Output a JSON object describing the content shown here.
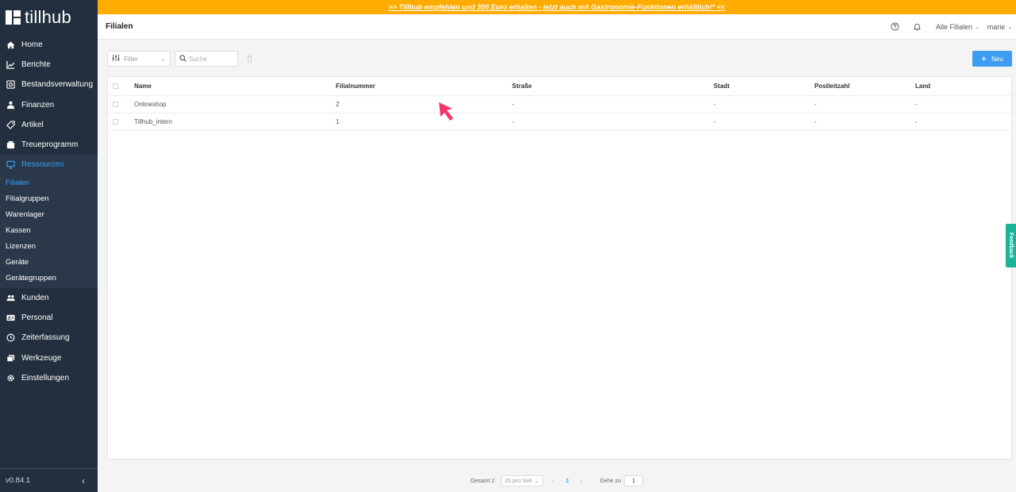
{
  "app": {
    "logo_text": "tillhub"
  },
  "banner": {
    "text": ">> Tillhub empfehlen und 300 Euro erhalten - jetzt auch mit Gastronomie-Funktionen erhältlich!* <<"
  },
  "header": {
    "title": "Filialen",
    "branch_selector": "Alle Filialen",
    "user": "marie"
  },
  "sidebar": {
    "items": [
      {
        "label": "Home",
        "icon": "home-icon"
      },
      {
        "label": "Berichte",
        "icon": "chart-icon"
      },
      {
        "label": "Bestandsverwaltung",
        "icon": "inventory-icon"
      },
      {
        "label": "Finanzen",
        "icon": "finance-icon"
      },
      {
        "label": "Artikel",
        "icon": "tag-icon"
      },
      {
        "label": "Treueprogramm",
        "icon": "loyalty-icon"
      },
      {
        "label": "Ressourcen",
        "icon": "monitor-icon"
      }
    ],
    "sub_items": [
      "Filialen",
      "Filialgruppen",
      "Warenlager",
      "Kassen",
      "Lizenzen",
      "Geräte",
      "Gerätegruppen"
    ],
    "items_after": [
      {
        "label": "Kunden",
        "icon": "customers-icon"
      },
      {
        "label": "Personal",
        "icon": "staff-icon"
      },
      {
        "label": "Zeiterfassung",
        "icon": "clock-icon"
      },
      {
        "label": "Werkzeuge",
        "icon": "tools-icon"
      },
      {
        "label": "Einstellungen",
        "icon": "gear-icon"
      }
    ],
    "version": "v0.84.1"
  },
  "toolbar": {
    "filter_label": "Filter",
    "search_placeholder": "Suche",
    "new_label": "Neu"
  },
  "table": {
    "columns": [
      "Name",
      "Filialnummer",
      "Straße",
      "Stadt",
      "Postleitzahl",
      "Land"
    ],
    "rows": [
      {
        "name": "Onlineshop",
        "number": "2",
        "street": "-",
        "city": "-",
        "zip": "-",
        "country": "-"
      },
      {
        "name": "Tillhub_intern",
        "number": "1",
        "street": "-",
        "city": "-",
        "zip": "-",
        "country": "-"
      }
    ]
  },
  "pagination": {
    "total": "Gesamt 2",
    "per_page": "20 pro Seit",
    "current_page": "1",
    "goto_label": "Gehe zu",
    "goto_value": "1"
  },
  "feedback": {
    "label": "Feedback"
  },
  "colors": {
    "sidebar_bg": "#232f3e",
    "accent": "#3d9df2",
    "banner": "#ffab00",
    "feedback": "#1bb39a",
    "cursor": "#f5346b"
  }
}
